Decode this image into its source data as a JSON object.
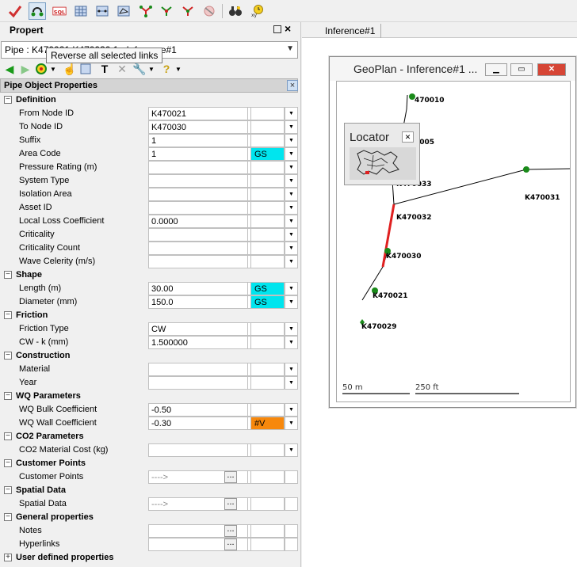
{
  "toolbar": {
    "tooltip": "Reverse all selected links",
    "buttons": [
      {
        "name": "check-icon"
      },
      {
        "name": "reverse-links-icon"
      },
      {
        "name": "sql-icon",
        "label": "SQL"
      },
      {
        "name": "grid-view-icon"
      },
      {
        "name": "link-grid-icon"
      },
      {
        "name": "polygon-grid-icon"
      },
      {
        "name": "network-trace-icon"
      },
      {
        "name": "network-trace-up-icon"
      },
      {
        "name": "network-trace-down-icon"
      },
      {
        "name": "network-trace-clear-icon"
      },
      {
        "name": "binoculars-icon"
      },
      {
        "name": "clock-icon"
      }
    ]
  },
  "panel": {
    "title": "Propert",
    "object_select": "Pipe : K470021.K470030.1 : Inference#1",
    "grid_header": "Pipe Object Properties"
  },
  "sections": [
    {
      "label": "Definition",
      "expanded": true,
      "rows": [
        {
          "label": "From Node ID",
          "value": "K470021",
          "flag": ""
        },
        {
          "label": "To Node ID",
          "value": "K470030",
          "flag": ""
        },
        {
          "label": "Suffix",
          "value": "1",
          "flag": ""
        },
        {
          "label": "Area Code",
          "value": "1",
          "flag": "GS"
        },
        {
          "label": "Pressure Rating (m)",
          "value": "",
          "flag": ""
        },
        {
          "label": "System Type",
          "value": "",
          "flag": ""
        },
        {
          "label": "Isolation Area",
          "value": "",
          "flag": ""
        },
        {
          "label": "Asset ID",
          "value": "",
          "flag": ""
        },
        {
          "label": "Local Loss Coefficient",
          "value": "0.0000",
          "flag": ""
        },
        {
          "label": "Criticality",
          "value": "",
          "flag": ""
        },
        {
          "label": "Criticality Count",
          "value": "",
          "flag": ""
        },
        {
          "label": "Wave Celerity (m/s)",
          "value": "",
          "flag": ""
        }
      ]
    },
    {
      "label": "Shape",
      "expanded": true,
      "rows": [
        {
          "label": "Length (m)",
          "value": "30.00",
          "flag": "GS"
        },
        {
          "label": "Diameter (mm)",
          "value": "150.0",
          "flag": "GS"
        }
      ]
    },
    {
      "label": "Friction",
      "expanded": true,
      "rows": [
        {
          "label": "Friction Type",
          "value": "CW",
          "flag": ""
        },
        {
          "label": "CW - k (mm)",
          "value": "1.500000",
          "flag": ""
        }
      ]
    },
    {
      "label": "Construction",
      "expanded": true,
      "rows": [
        {
          "label": "Material",
          "value": "",
          "flag": ""
        },
        {
          "label": "Year",
          "value": "",
          "flag": ""
        }
      ]
    },
    {
      "label": "WQ Parameters",
      "expanded": true,
      "rows": [
        {
          "label": "WQ Bulk Coefficient",
          "value": "-0.50",
          "flag": ""
        },
        {
          "label": "WQ Wall Coefficient",
          "value": "-0.30",
          "flag": "#V"
        }
      ]
    },
    {
      "label": "CO2 Parameters",
      "expanded": true,
      "rows": [
        {
          "label": "CO2 Material Cost (kg)",
          "value": "",
          "flag": ""
        }
      ]
    },
    {
      "label": "Customer Points",
      "expanded": true,
      "rows": [
        {
          "label": "Customer Points",
          "value": "---->",
          "flag": "",
          "ellipsis": true
        }
      ]
    },
    {
      "label": "Spatial Data",
      "expanded": true,
      "rows": [
        {
          "label": "Spatial Data",
          "value": "---->",
          "flag": "",
          "ellipsis": true
        }
      ]
    },
    {
      "label": "General properties",
      "expanded": true,
      "rows": [
        {
          "label": "Notes",
          "value": "",
          "flag": "",
          "ellipsis": true
        },
        {
          "label": "Hyperlinks",
          "value": "",
          "flag": "",
          "ellipsis": true
        }
      ]
    },
    {
      "label": "User defined properties",
      "expanded": false,
      "rows": []
    }
  ],
  "right": {
    "tab": "Inference#1",
    "geoplan_title": "GeoPlan - Inference#1 ...",
    "locator_title": "Locator",
    "scale_m": "50 m",
    "scale_ft": "250 ft",
    "nodes": [
      {
        "label": "470010"
      },
      {
        "label": "0005"
      },
      {
        "label": "K470033"
      },
      {
        "label": "K470032"
      },
      {
        "label": "K470030"
      },
      {
        "label": "K470021"
      },
      {
        "label": "K470029"
      },
      {
        "label": "K470031"
      }
    ],
    "colors": {
      "node": "#1a8a1a",
      "selected_link": "#e02020",
      "link": "#000000"
    }
  }
}
